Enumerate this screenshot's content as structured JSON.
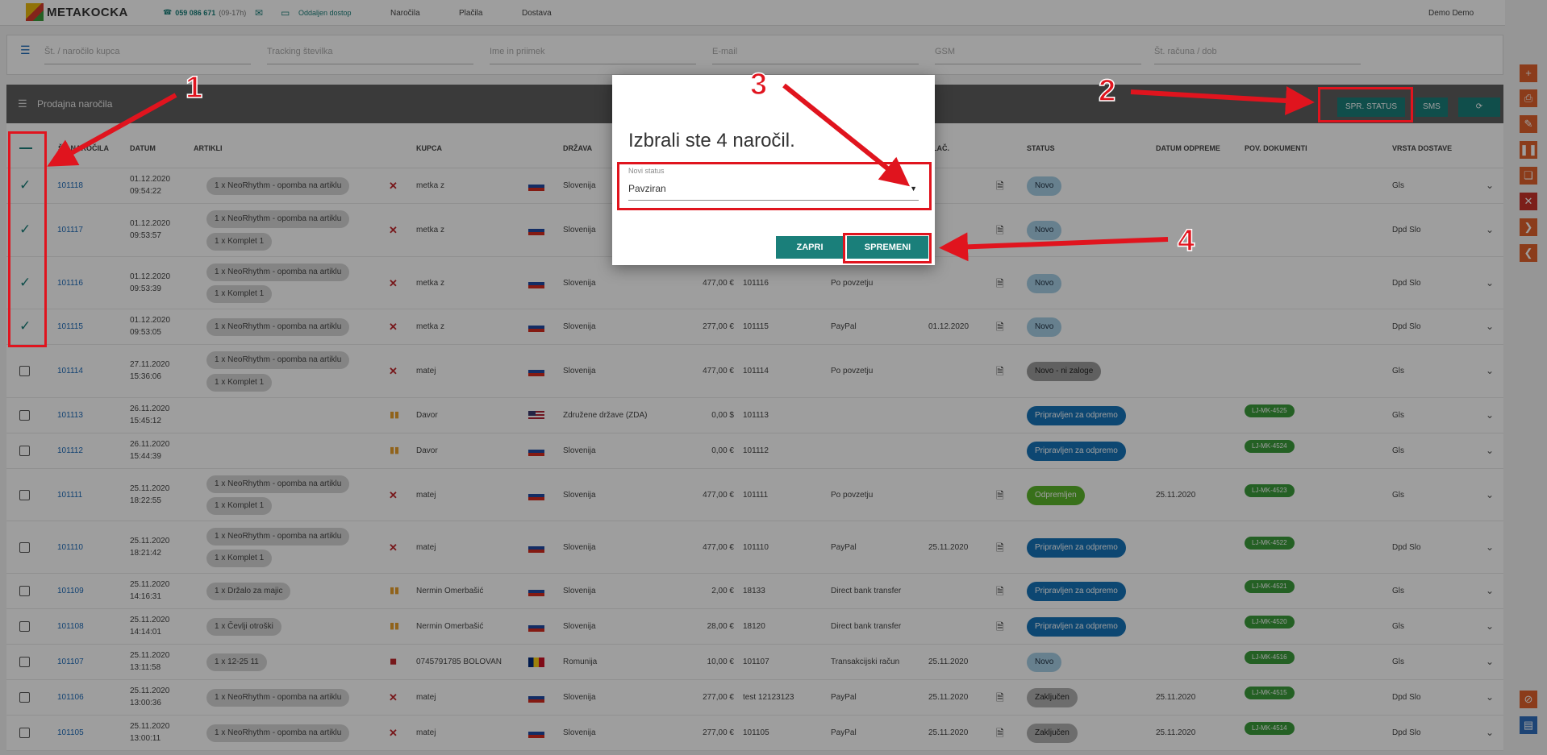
{
  "topbar": {
    "logo_text": "METAKOCKA",
    "phone": "059 086 671",
    "phone_hours": "(09-17h)",
    "remote": "Oddaljen dostop",
    "nav": [
      "Naročila",
      "Plačila",
      "Dostava"
    ],
    "user": "Demo Demo"
  },
  "search": {
    "fields": [
      "Št. / naročilo kupca",
      "Tracking številka",
      "Ime in priimek",
      "E-mail",
      "GSM",
      "Št. računa / dob"
    ]
  },
  "section": {
    "title": "Prodajna naročila",
    "buttons": {
      "status": "SPR. STATUS",
      "sms": "SMS",
      "refresh_icon": "refresh-icon"
    }
  },
  "table": {
    "columns": [
      "ŠT. NAROČILA",
      "DATUM",
      "ARTIKLI",
      "KUPCA",
      "DRŽAVA",
      "PLAČ.",
      "STATUS",
      "DATUM ODPREME",
      "POV. DOKUMENTI",
      "VRSTA DOSTAVE"
    ],
    "rows": [
      {
        "checked": true,
        "id": "101118",
        "date": "01.12.2020",
        "time": "09:54:22",
        "items": [
          "1 x NeoRhythm - opomba na artiklu"
        ],
        "src": "x",
        "customer": "metka z",
        "flag": "si",
        "country": "Slovenija",
        "amount": "",
        "ref": "",
        "payment": "",
        "paid": "",
        "doc": true,
        "status": "Novo",
        "st": "novo",
        "ship_date": "",
        "docs": "",
        "delivery": "Gls"
      },
      {
        "checked": true,
        "id": "101117",
        "date": "01.12.2020",
        "time": "09:53:57",
        "items": [
          "1 x NeoRhythm - opomba na artiklu",
          "1 x Komplet 1"
        ],
        "src": "x",
        "customer": "metka z",
        "flag": "si",
        "country": "Slovenija",
        "amount": "",
        "ref": "",
        "payment": "",
        "paid": "",
        "doc": true,
        "status": "Novo",
        "st": "novo",
        "ship_date": "",
        "docs": "",
        "delivery": "Dpd Slo"
      },
      {
        "checked": true,
        "id": "101116",
        "date": "01.12.2020",
        "time": "09:53:39",
        "items": [
          "1 x NeoRhythm - opomba na artiklu",
          "1 x Komplet 1"
        ],
        "src": "x",
        "customer": "metka z",
        "flag": "si",
        "country": "Slovenija",
        "amount": "477,00 €",
        "ref": "101116",
        "payment": "Po povzetju",
        "paid": "",
        "doc": true,
        "status": "Novo",
        "st": "novo",
        "ship_date": "",
        "docs": "",
        "delivery": "Dpd Slo"
      },
      {
        "checked": true,
        "id": "101115",
        "date": "01.12.2020",
        "time": "09:53:05",
        "items": [
          "1 x NeoRhythm - opomba na artiklu"
        ],
        "src": "x",
        "customer": "metka z",
        "flag": "si",
        "country": "Slovenija",
        "amount": "277,00 €",
        "ref": "101115",
        "payment": "PayPal",
        "paid": "01.12.2020",
        "doc": true,
        "status": "Novo",
        "st": "novo",
        "ship_date": "",
        "docs": "",
        "delivery": "Dpd Slo"
      },
      {
        "checked": false,
        "id": "101114",
        "date": "27.11.2020",
        "time": "15:36:06",
        "items": [
          "1 x NeoRhythm - opomba na artiklu",
          "1 x Komplet 1"
        ],
        "src": "x",
        "customer": "matej",
        "flag": "si",
        "country": "Slovenija",
        "amount": "477,00 €",
        "ref": "101114",
        "payment": "Po povzetju",
        "paid": "",
        "doc": true,
        "status": "Novo - ni zaloge",
        "st": "noz",
        "ship_date": "",
        "docs": "",
        "delivery": "Gls"
      },
      {
        "checked": false,
        "id": "101113",
        "date": "26.11.2020",
        "time": "15:45:12",
        "items": [],
        "src": "bar",
        "customer": "Davor",
        "flag": "us",
        "country": "Združene države (ZDA)",
        "amount": "0,00 $",
        "ref": "101113",
        "payment": "",
        "paid": "",
        "doc": false,
        "status": "Pripravljen za odpremo",
        "st": "prip",
        "ship_date": "",
        "docs": "LJ-MK-4525",
        "delivery": "Gls"
      },
      {
        "checked": false,
        "id": "101112",
        "date": "26.11.2020",
        "time": "15:44:39",
        "items": [],
        "src": "bar",
        "customer": "Davor",
        "flag": "si",
        "country": "Slovenija",
        "amount": "0,00 €",
        "ref": "101112",
        "payment": "",
        "paid": "",
        "doc": false,
        "status": "Pripravljen za odpremo",
        "st": "prip",
        "ship_date": "",
        "docs": "LJ-MK-4524",
        "delivery": "Gls"
      },
      {
        "checked": false,
        "id": "101111",
        "date": "25.11.2020",
        "time": "18:22:55",
        "items": [
          "1 x NeoRhythm - opomba na artiklu",
          "1 x Komplet 1"
        ],
        "src": "x",
        "customer": "matej",
        "flag": "si",
        "country": "Slovenija",
        "amount": "477,00 €",
        "ref": "101111",
        "payment": "Po povzetju",
        "paid": "",
        "doc": true,
        "status": "Odpremljen",
        "st": "odp",
        "ship_date": "25.11.2020",
        "docs": "LJ-MK-4523",
        "delivery": "Gls"
      },
      {
        "checked": false,
        "id": "101110",
        "date": "25.11.2020",
        "time": "18:21:42",
        "items": [
          "1 x NeoRhythm - opomba na artiklu",
          "1 x Komplet 1"
        ],
        "src": "x",
        "customer": "matej",
        "flag": "si",
        "country": "Slovenija",
        "amount": "477,00 €",
        "ref": "101110",
        "payment": "PayPal",
        "paid": "25.11.2020",
        "doc": true,
        "status": "Pripravljen za odpremo",
        "st": "prip",
        "ship_date": "",
        "docs": "LJ-MK-4522",
        "delivery": "Dpd Slo"
      },
      {
        "checked": false,
        "id": "101109",
        "date": "25.11.2020",
        "time": "14:16:31",
        "items": [
          "1 x Držalo za majic"
        ],
        "src": "bar",
        "customer": "Nermin Omerbašić",
        "flag": "si",
        "country": "Slovenija",
        "amount": "2,00 €",
        "ref": "18133",
        "payment": "Direct bank transfer",
        "paid": "",
        "doc": true,
        "status": "Pripravljen za odpremo",
        "st": "prip",
        "ship_date": "",
        "docs": "LJ-MK-4521",
        "delivery": "Gls"
      },
      {
        "checked": false,
        "id": "101108",
        "date": "25.11.2020",
        "time": "14:14:01",
        "items": [
          "1 x Čevlji otroški"
        ],
        "src": "bar",
        "customer": "Nermin Omerbašić",
        "flag": "si",
        "country": "Slovenija",
        "amount": "28,00 €",
        "ref": "18120",
        "payment": "Direct bank transfer",
        "paid": "",
        "doc": true,
        "status": "Pripravljen za odpremo",
        "st": "prip",
        "ship_date": "",
        "docs": "LJ-MK-4520",
        "delivery": "Gls"
      },
      {
        "checked": false,
        "id": "101107",
        "date": "25.11.2020",
        "time": "13:11:58",
        "items": [
          "1 x 12-25 11"
        ],
        "src": "shop",
        "customer": "0745791785 BOLOVAN",
        "flag": "ro",
        "country": "Romunija",
        "amount": "10,00 €",
        "ref": "101107",
        "payment": "Transakcijski račun",
        "paid": "25.11.2020",
        "doc": false,
        "status": "Novo",
        "st": "novo",
        "ship_date": "",
        "docs": "LJ-MK-4516",
        "delivery": "Gls"
      },
      {
        "checked": false,
        "id": "101106",
        "date": "25.11.2020",
        "time": "13:00:36",
        "items": [
          "1 x NeoRhythm - opomba na artiklu"
        ],
        "src": "x",
        "customer": "matej",
        "flag": "si",
        "country": "Slovenija",
        "amount": "277,00 €",
        "ref": "test 12123123",
        "payment": "PayPal",
        "paid": "25.11.2020",
        "doc": true,
        "status": "Zaključen",
        "st": "zak",
        "ship_date": "25.11.2020",
        "docs": "LJ-MK-4515",
        "delivery": "Dpd Slo"
      },
      {
        "checked": false,
        "id": "101105",
        "date": "25.11.2020",
        "time": "13:00:11",
        "items": [
          "1 x NeoRhythm - opomba na artiklu"
        ],
        "src": "x",
        "customer": "matej",
        "flag": "si",
        "country": "Slovenija",
        "amount": "277,00 €",
        "ref": "101105",
        "payment": "PayPal",
        "paid": "25.11.2020",
        "doc": true,
        "status": "Zaključen",
        "st": "zak",
        "ship_date": "25.11.2020",
        "docs": "LJ-MK-4514",
        "delivery": "Dpd Slo"
      }
    ]
  },
  "dialog": {
    "title": "Izbrali ste 4 naročil.",
    "field_label": "Novi status",
    "field_value": "Pavziran",
    "close_label": "ZAPRI",
    "confirm_label": "SPREMENI"
  },
  "annotations": [
    "1",
    "2",
    "3",
    "4"
  ]
}
